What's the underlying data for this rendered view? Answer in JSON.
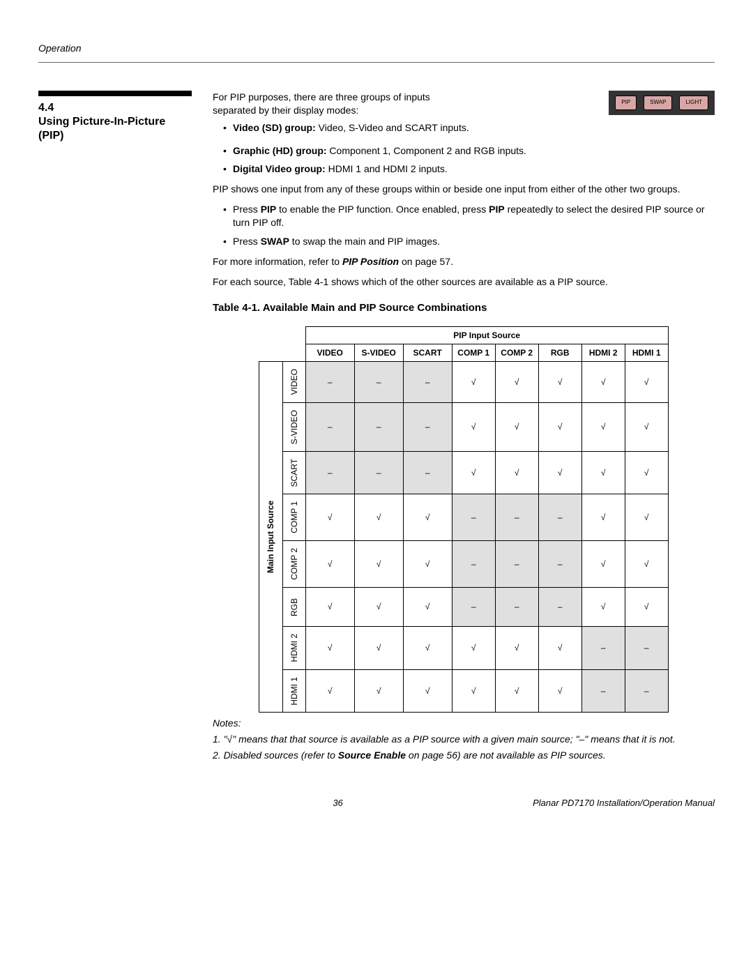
{
  "header": {
    "section": "Operation"
  },
  "section": {
    "number": "4.4",
    "title_l1": "Using Picture-In-Picture",
    "title_l2": "(PIP)"
  },
  "intro": {
    "p1a": "For PIP purposes, there are three groups of inputs",
    "p1b": "separated by their display modes:",
    "bullets1": [
      {
        "bold": "Video (SD) group:",
        "rest": " Video, S-Video and SCART inputs."
      },
      {
        "bold": "Graphic (HD) group:",
        "rest": "  Component 1, Component 2 and RGB inputs."
      },
      {
        "bold": "Digital Video group:",
        "rest": "  HDMI 1 and HDMI 2 inputs."
      }
    ],
    "p2": "PIP shows one input from any of these groups within or beside one input from either of the other two groups.",
    "bullets2_a_pre": "Press ",
    "bullets2_a_b1": "PIP",
    "bullets2_a_mid": " to enable the PIP function. Once enabled, press ",
    "bullets2_a_b2": "PIP",
    "bullets2_a_post": " repeatedly to select the desired PIP source or turn PIP off.",
    "bullets2_b_pre": "Press ",
    "bullets2_b_b": "SWAP",
    "bullets2_b_post": " to swap the main and PIP images.",
    "p3_pre": "For more information, refer to ",
    "p3_bi": "PIP Position",
    "p3_post": " on page 57.",
    "p4": "For each source, Table 4-1 shows which of the other sources are available as a PIP source."
  },
  "buttons": {
    "b1": "PIP",
    "b2": "SWAP",
    "b3": "LIGHT"
  },
  "table": {
    "title": "Table 4-1. Available Main and PIP Source Combinations",
    "pip_header": "PIP Input Source",
    "main_header": "Main Input Source",
    "cols": [
      "VIDEO",
      "S-VIDEO",
      "SCART",
      "COMP 1",
      "COMP 2",
      "RGB",
      "HDMI 2",
      "HDMI 1"
    ],
    "rows": [
      "VIDEO",
      "S-VIDEO",
      "SCART",
      "COMP 1",
      "COMP 2",
      "RGB",
      "HDMI 2",
      "HDMI 1"
    ],
    "yes": "√",
    "no": "–",
    "grid": [
      [
        "no",
        "no",
        "no",
        "yes",
        "yes",
        "yes",
        "yes",
        "yes"
      ],
      [
        "no",
        "no",
        "no",
        "yes",
        "yes",
        "yes",
        "yes",
        "yes"
      ],
      [
        "no",
        "no",
        "no",
        "yes",
        "yes",
        "yes",
        "yes",
        "yes"
      ],
      [
        "yes",
        "yes",
        "yes",
        "no",
        "no",
        "no",
        "yes",
        "yes"
      ],
      [
        "yes",
        "yes",
        "yes",
        "no",
        "no",
        "no",
        "yes",
        "yes"
      ],
      [
        "yes",
        "yes",
        "yes",
        "no",
        "no",
        "no",
        "yes",
        "yes"
      ],
      [
        "yes",
        "yes",
        "yes",
        "yes",
        "yes",
        "yes",
        "no",
        "no"
      ],
      [
        "yes",
        "yes",
        "yes",
        "yes",
        "yes",
        "yes",
        "no",
        "no"
      ]
    ]
  },
  "notes": {
    "heading": "Notes:",
    "n1": "1. \"√\" means that that source is available as a PIP source with a given main source; \"–\" means that it is not.",
    "n2_pre": "2. Disabled sources (refer to ",
    "n2_b": "Source Enable",
    "n2_post": " on page 56) are not available as PIP sources."
  },
  "footer": {
    "page": "36",
    "doc": "Planar PD7170 Installation/Operation Manual"
  }
}
